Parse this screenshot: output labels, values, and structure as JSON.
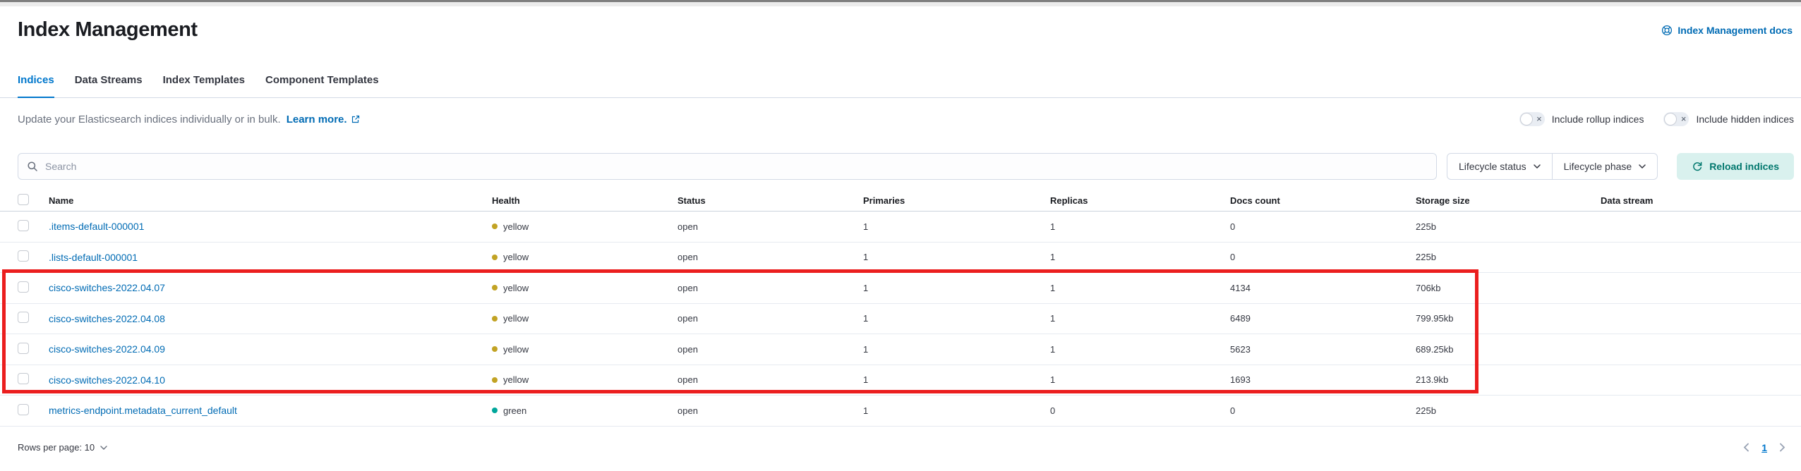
{
  "page": {
    "title": "Index Management"
  },
  "header": {
    "docs_link_label": "Index Management docs"
  },
  "tabs": [
    {
      "label": "Indices",
      "active": true
    },
    {
      "label": "Data Streams",
      "active": false
    },
    {
      "label": "Index Templates",
      "active": false
    },
    {
      "label": "Component Templates",
      "active": false
    }
  ],
  "description": {
    "text": "Update your Elasticsearch indices individually or in bulk.",
    "link_label": "Learn more."
  },
  "toggles": [
    {
      "label": "Include rollup indices",
      "state": "off"
    },
    {
      "label": "Include hidden indices",
      "state": "off"
    }
  ],
  "toolbar": {
    "search_placeholder": "Search",
    "filters": [
      {
        "label": "Lifecycle status"
      },
      {
        "label": "Lifecycle phase"
      }
    ],
    "reload_label": "Reload indices"
  },
  "table": {
    "columns": [
      "Name",
      "Health",
      "Status",
      "Primaries",
      "Replicas",
      "Docs count",
      "Storage size",
      "Data stream"
    ],
    "rows": [
      {
        "name": ".items-default-000001",
        "health": "yellow",
        "status": "open",
        "primaries": "1",
        "replicas": "1",
        "docs_count": "0",
        "storage_size": "225b",
        "data_stream": "",
        "highlighted": false
      },
      {
        "name": ".lists-default-000001",
        "health": "yellow",
        "status": "open",
        "primaries": "1",
        "replicas": "1",
        "docs_count": "0",
        "storage_size": "225b",
        "data_stream": "",
        "highlighted": false
      },
      {
        "name": "cisco-switches-2022.04.07",
        "health": "yellow",
        "status": "open",
        "primaries": "1",
        "replicas": "1",
        "docs_count": "4134",
        "storage_size": "706kb",
        "data_stream": "",
        "highlighted": true
      },
      {
        "name": "cisco-switches-2022.04.08",
        "health": "yellow",
        "status": "open",
        "primaries": "1",
        "replicas": "1",
        "docs_count": "6489",
        "storage_size": "799.95kb",
        "data_stream": "",
        "highlighted": true
      },
      {
        "name": "cisco-switches-2022.04.09",
        "health": "yellow",
        "status": "open",
        "primaries": "1",
        "replicas": "1",
        "docs_count": "5623",
        "storage_size": "689.25kb",
        "data_stream": "",
        "highlighted": true
      },
      {
        "name": "cisco-switches-2022.04.10",
        "health": "yellow",
        "status": "open",
        "primaries": "1",
        "replicas": "1",
        "docs_count": "1693",
        "storage_size": "213.9kb",
        "data_stream": "",
        "highlighted": true
      },
      {
        "name": "metrics-endpoint.metadata_current_default",
        "health": "green",
        "status": "open",
        "primaries": "1",
        "replicas": "0",
        "docs_count": "0",
        "storage_size": "225b",
        "data_stream": "",
        "highlighted": false
      }
    ]
  },
  "annotation": {
    "type": "red-rectangle",
    "color": "#EB1E1E",
    "rows_covered": [
      "cisco-switches-2022.04.07",
      "cisco-switches-2022.04.08",
      "cisco-switches-2022.04.09",
      "cisco-switches-2022.04.10"
    ]
  },
  "footer": {
    "rows_per_page_label": "Rows per page: 10",
    "current_page": "1"
  },
  "colors": {
    "accent_blue": "#0077CC",
    "link_blue": "#006BB4",
    "health_yellow": "#C2A324",
    "health_green": "#00A69B",
    "reload_bg": "#D9F1EE",
    "reload_text": "#00776D",
    "highlight_red": "#EB1E1E"
  }
}
